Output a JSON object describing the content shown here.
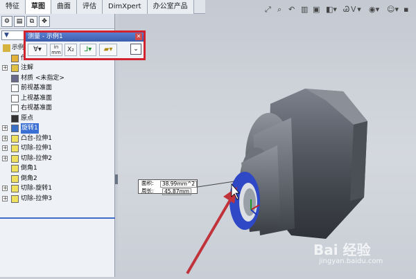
{
  "tabs": [
    "特征",
    "草图",
    "曲面",
    "评估",
    "DimXpert",
    "办公室产品"
  ],
  "active_tab": 1,
  "panel": {
    "filter_label": "",
    "tree_root": "示例",
    "items": [
      {
        "label": "传感器",
        "expand": "",
        "icon": "sensor-icon"
      },
      {
        "label": "注解",
        "expand": "+",
        "icon": "annotation-icon"
      },
      {
        "label": "材质 <未指定>",
        "expand": "",
        "icon": "material-icon"
      },
      {
        "label": "前视基准面",
        "expand": "",
        "icon": "plane-icon"
      },
      {
        "label": "上视基准面",
        "expand": "",
        "icon": "plane-icon"
      },
      {
        "label": "右视基准面",
        "expand": "",
        "icon": "plane-icon"
      },
      {
        "label": "原点",
        "expand": "",
        "icon": "origin-icon"
      },
      {
        "label": "旋转1",
        "expand": "+",
        "icon": "revolve-icon",
        "selected": true
      },
      {
        "label": "凸台-拉伸1",
        "expand": "+",
        "icon": "extrude-icon"
      },
      {
        "label": "切除-拉伸1",
        "expand": "+",
        "icon": "cut-extrude-icon"
      },
      {
        "label": "切除-拉伸2",
        "expand": "+",
        "icon": "cut-extrude-icon"
      },
      {
        "label": "倒角1",
        "expand": "",
        "icon": "chamfer-icon"
      },
      {
        "label": "倒角2",
        "expand": "",
        "icon": "chamfer-icon"
      },
      {
        "label": "切除-旋转1",
        "expand": "+",
        "icon": "cut-revolve-icon"
      },
      {
        "label": "切除-拉伸3",
        "expand": "+",
        "icon": "cut-extrude-icon"
      }
    ],
    "collapse_glyph": "»"
  },
  "measure": {
    "title": "测量 - 示例1",
    "units_label_top": "in",
    "units_label_bottom": "mm",
    "xyz_label": "X₂",
    "expand_glyph": "⌄"
  },
  "callout": {
    "area_label": "面积:",
    "area_value": "38.99mm^2",
    "perimeter_label": "周长:",
    "perimeter_value": "45.87mm"
  },
  "watermark": {
    "brand": "Bai 经验",
    "url": "jingyan.baidu.com"
  },
  "colors": {
    "highlight_red": "#d2222e",
    "selection_blue": "#3a6fd3",
    "arrow_red": "#c0333b"
  }
}
